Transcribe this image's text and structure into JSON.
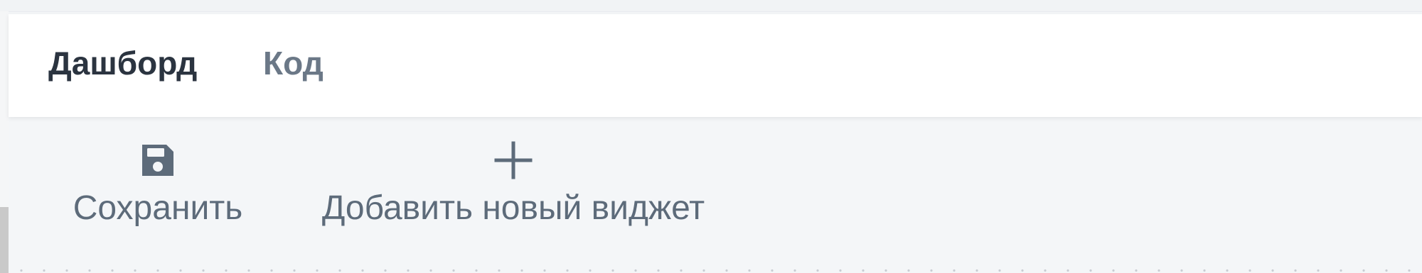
{
  "tabs": [
    {
      "label": "Дашборд",
      "active": true
    },
    {
      "label": "Код",
      "active": false
    }
  ],
  "toolbar": {
    "save_label": "Сохранить",
    "add_widget_label": "Добавить новый виджет"
  },
  "icons": {
    "save": "floppy-disk-icon",
    "add": "plus-icon"
  },
  "colors": {
    "active_tab": "#2b3440",
    "inactive_tab": "#6b7887",
    "toolbar_text": "#5d6b7a",
    "toolbar_background": "#f4f6f8",
    "tab_bar_background": "#ffffff"
  }
}
